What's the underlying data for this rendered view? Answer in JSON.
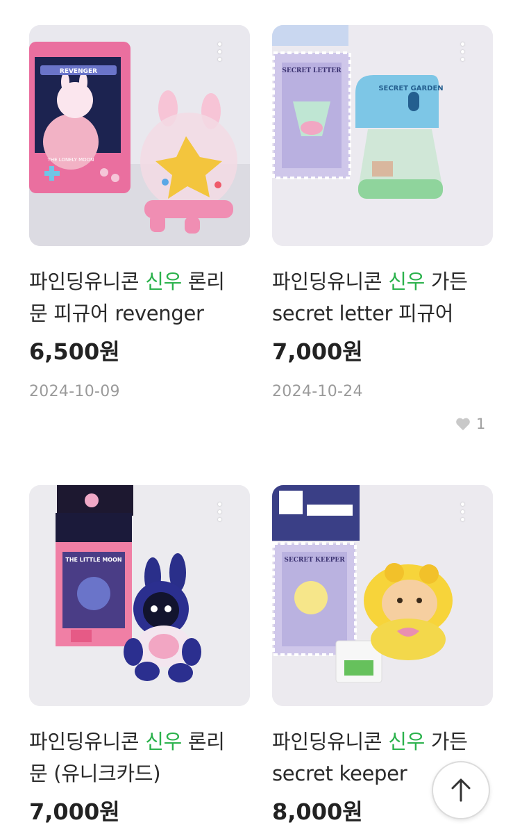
{
  "listings": [
    {
      "title_prefix": "파인딩유니콘 ",
      "title_highlight": "신우",
      "title_line1_suffix": " 론리",
      "title_line2": "문 피규어 revenger",
      "price": "6,500원",
      "date": "2024-10-09",
      "likes": null,
      "image_card_text": "REVENGER",
      "image_card_footer": "THE LONELY MOON"
    },
    {
      "title_prefix": "파인딩유니콘 ",
      "title_highlight": "신우",
      "title_line1_suffix": " 가든",
      "title_line2": "secret letter 피규어",
      "price": "7,000원",
      "date": "2024-10-24",
      "likes": "1",
      "image_card_text": "SECRET LETTER",
      "image_sign_text": "SECRET GARDEN"
    },
    {
      "title_prefix": "파인딩유니콘 ",
      "title_highlight": "신우",
      "title_line1_suffix": " 론리",
      "title_line2": "문 (유니크카드)",
      "price": "7,000원",
      "image_card_text": "THE LITTLE MOON"
    },
    {
      "title_prefix": "파인딩유니콘 ",
      "title_highlight": "신우",
      "title_line1_suffix": " 가든",
      "title_line2": "secret keeper",
      "price": "8,000원",
      "image_card_text": "SECRET KEEPER"
    }
  ],
  "colors": {
    "highlight": "#2bb24c",
    "price": "#222222",
    "date": "#9a9a9a"
  },
  "icons": {
    "more": "more-vertical-icon",
    "like": "heart-icon",
    "scroll_top": "arrow-up-icon"
  }
}
